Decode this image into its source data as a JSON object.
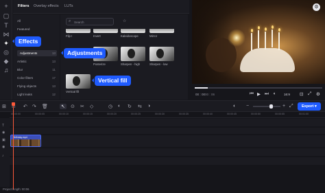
{
  "rail": {
    "items": [
      {
        "icon": "plus-icon",
        "glyph": "+"
      },
      {
        "icon": "media-icon",
        "glyph": "▢"
      },
      {
        "icon": "text-icon",
        "glyph": "T"
      },
      {
        "icon": "transitions-icon",
        "glyph": "⋈"
      },
      {
        "icon": "effects-icon",
        "glyph": "✦"
      },
      {
        "icon": "filters-icon",
        "glyph": "◎"
      },
      {
        "icon": "stickers-icon",
        "glyph": "◆"
      },
      {
        "icon": "music-icon",
        "glyph": "♫"
      }
    ]
  },
  "filter_panel": {
    "tabs": [
      {
        "label": "Filters",
        "active": true
      },
      {
        "label": "Overlay effects",
        "active": false
      },
      {
        "label": "LUTs",
        "active": false
      }
    ],
    "categories": [
      {
        "label": "All",
        "count": "",
        "active": false
      },
      {
        "label": "Featured",
        "count": "",
        "active": false
      },
      {
        "label": "",
        "count": "",
        "active": false
      },
      {
        "label": "",
        "count": "",
        "active": false
      },
      {
        "label": "",
        "count": "",
        "active": false
      },
      {
        "label": "Adjustments",
        "count": "13",
        "active": true
      },
      {
        "label": "Artistic",
        "count": "13",
        "active": false
      },
      {
        "label": "Blur",
        "count": "11",
        "active": false
      },
      {
        "label": "Color filters",
        "count": "17",
        "active": false
      },
      {
        "label": "Flying objects",
        "count": "13",
        "active": false
      },
      {
        "label": "Light leaks",
        "count": "12",
        "active": false
      }
    ],
    "search_placeholder": "Search",
    "thumbs_row1": [
      "Flip I",
      "Invert",
      "Kaleidoscope",
      "Mirror"
    ],
    "thumbs_row2": [
      "Posterize",
      "Sharpen - high",
      "Sharpen - low"
    ],
    "thumbs_row3": [
      "Vertical fill"
    ]
  },
  "callouts": {
    "effects": "Effects",
    "adjustments": "Adjustments",
    "vertical_fill": "Vertical fill"
  },
  "preview": {
    "time_current": "00 : 00",
    "time_total": "00 : 06",
    "aspect": "16:9",
    "progress": 0.1
  },
  "toolbar": {
    "export_label": "Export"
  },
  "timeline": {
    "ticks": [
      "00:00:00",
      "00:00:05",
      "00:00:10",
      "00:00:15",
      "00:00:20",
      "00:00:25",
      "00:00:30",
      "00:00:35",
      "00:00:40",
      "00:00:45",
      "00:00:50",
      "00:00:55",
      "00:01:00"
    ],
    "clip_name": "Birthday.mp4",
    "project_length": "Project length: 00:06"
  }
}
